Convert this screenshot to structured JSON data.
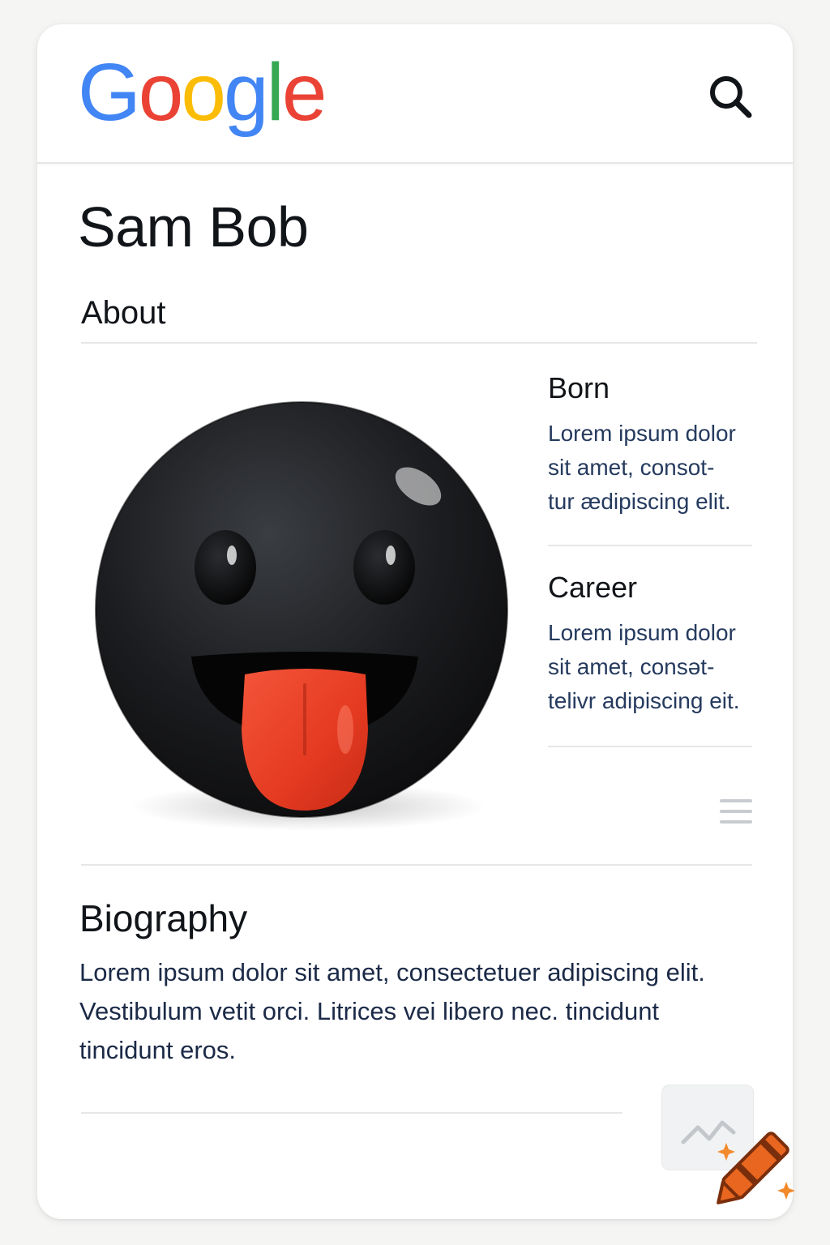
{
  "header": {
    "logo": {
      "letters": [
        "G",
        "o",
        "o",
        "g",
        "l",
        "e"
      ],
      "colors": [
        "#4285F4",
        "#EA4335",
        "#FBBC05",
        "#4285F4",
        "#34A853",
        "#EA4335"
      ]
    },
    "search_icon": "search-icon"
  },
  "profile": {
    "name": "Sam Bob",
    "about_heading": "About",
    "avatar_icon": "tongue-out-emoji-icon"
  },
  "facts": {
    "born": {
      "heading": "Born",
      "text": "Lorem ipsum dolor\nsit amet, consot-\ntur ædipiscing elit."
    },
    "career": {
      "heading": "Career",
      "text": "Lorem ipsum dolor\nsit amet, consət-\ntelivr adipiscing eit."
    },
    "menu_icon": "menu-icon"
  },
  "biography": {
    "heading": "Biography",
    "text": "Lorem ipsum dolor sit amet, consectetuer adipiscing elit. Vestibulum vetit orci. Litrices vei libero nec. tincidunt tincidunt eros."
  },
  "icons": {
    "image_placeholder": "image-placeholder-icon",
    "watermark": "crayon-logo-icon"
  },
  "colors": {
    "text_dark": "#111418",
    "text_body": "#253a5e",
    "divider": "#e7e7e7",
    "tongue": "#e83a22",
    "crayon": "#e8661f"
  }
}
